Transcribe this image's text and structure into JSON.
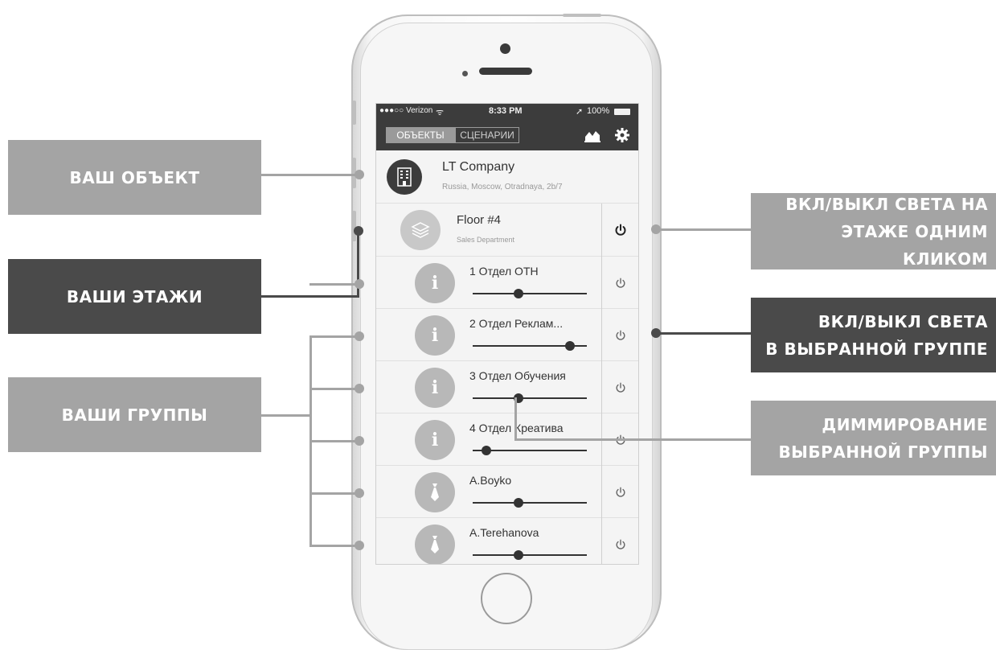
{
  "callouts": {
    "object": "ВАШ ОБЪЕКТ",
    "floors": "ВАШИ ЭТАЖИ",
    "groups": "ВАШИ ГРУППЫ",
    "floor_power": [
      "ВКЛ/ВЫКЛ СВЕТА НА",
      "ЭТАЖЕ ОДНИМ КЛИКОМ"
    ],
    "group_power": [
      "ВКЛ/ВЫКЛ СВЕТА",
      "В ВЫБРАННОЙ ГРУППЕ"
    ],
    "dimming": [
      "ДИММИРОВАНИЕ",
      "ВЫБРАННОЙ ГРУППЫ"
    ]
  },
  "status_bar": {
    "carrier": "●●●○○ Verizon",
    "wifi": "ᯤ",
    "time": "8:33 PM",
    "location": "➚",
    "battery": "100%"
  },
  "nav": {
    "tabs": [
      "ОБЪЕКТЫ",
      "СЦЕНАРИИ"
    ],
    "active_tab": "ОБЪЕКТЫ",
    "chart_icon": "area-chart-icon",
    "settings_icon": "gear-icon"
  },
  "company": {
    "name": "LT Company",
    "address": "Russia, Moscow, Otradnaya, 2b/7"
  },
  "floor": {
    "name": "Floor #4",
    "department": "Sales Department"
  },
  "groups": [
    {
      "name": "1 Отдел ОТН",
      "icon": "info-icon",
      "level": 0.4
    },
    {
      "name": "2 Отдел Реклам...",
      "icon": "info-icon",
      "level": 0.85
    },
    {
      "name": "3 Отдел Обучения",
      "icon": "info-icon",
      "level": 0.4
    },
    {
      "name": "4 Отдел Креатива",
      "icon": "info-icon",
      "level": 0.12
    },
    {
      "name": "A.Boyko",
      "icon": "tie-icon",
      "level": 0.4
    },
    {
      "name": "A.Terehanova",
      "icon": "tie-icon",
      "level": 0.4
    }
  ],
  "colors": {
    "callout_light": "#a4a4a4",
    "callout_dark": "#4a4a4a",
    "bar": "#3c3c3c"
  }
}
